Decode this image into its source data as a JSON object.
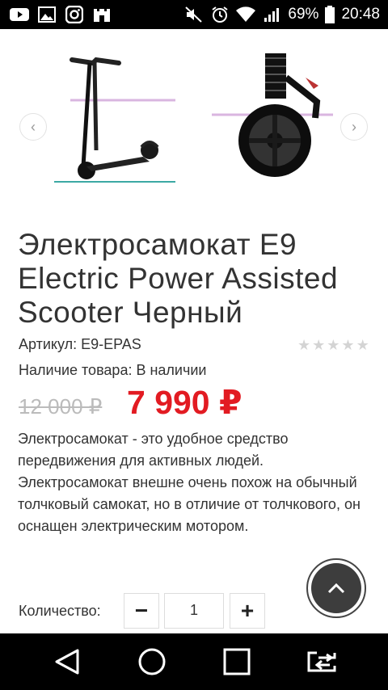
{
  "status_bar": {
    "battery_percent": "69%",
    "time": "20:48",
    "icons_left": [
      "youtube-icon",
      "gallery-icon",
      "instagram-icon",
      "castle-icon"
    ],
    "icons_right": [
      "mute-icon",
      "alarm-icon",
      "wifi-icon",
      "signal-icon",
      "battery-icon"
    ]
  },
  "gallery": {
    "prev_label": "‹",
    "next_label": "›",
    "images": [
      "scooter-full-image",
      "scooter-wheel-image"
    ],
    "active_index": 0
  },
  "product": {
    "title": "Электросамокат E9 Electric Power Assisted Scooter Черный",
    "sku": "Артикул: E9-EPAS",
    "stock": "Наличие товара: В наличии",
    "rating": 0,
    "rating_max": 5,
    "old_price": "12 000 ₽",
    "new_price": "7 990 ₽",
    "description": "Электросамокат - это удобное средство передвижения для активных людей. Электросамокат внешне очень похож на обычный толчковый самокат, но в отличие от толчкового, он оснащен электрическим мотором."
  },
  "quantity": {
    "label": "Количество:",
    "value": "1",
    "minus": "−",
    "plus": "+"
  },
  "colors": {
    "price_red": "#e21b22",
    "active_underline": "#3ca9a4"
  },
  "nav": [
    "back-icon",
    "home-icon",
    "recents-icon",
    "switch-apps-icon"
  ]
}
